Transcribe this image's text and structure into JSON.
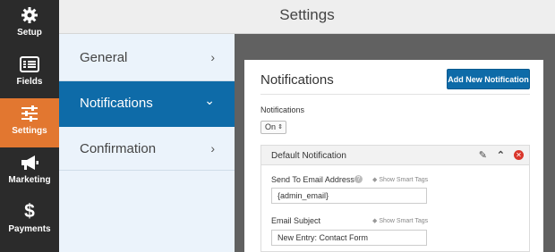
{
  "rail": {
    "items": [
      {
        "label": "Setup",
        "icon": "gear-icon"
      },
      {
        "label": "Fields",
        "icon": "fields-list-icon"
      },
      {
        "label": "Settings",
        "icon": "sliders-icon",
        "active": true
      },
      {
        "label": "Marketing",
        "icon": "megaphone-icon"
      },
      {
        "label": "Payments",
        "icon": "dollar-icon"
      }
    ]
  },
  "header": {
    "title": "Settings"
  },
  "sections": [
    {
      "label": "General",
      "chevron": "›"
    },
    {
      "label": "Notifications",
      "chevron": "⌄",
      "active": true
    },
    {
      "label": "Confirmation",
      "chevron": "›"
    }
  ],
  "panel": {
    "title": "Notifications",
    "add_button": "Add New Notification",
    "notifications_label": "Notifications",
    "notifications_value": "On",
    "block": {
      "title": "Default Notification",
      "send_to_label": "Send To Email Address",
      "send_to_value": "{admin_email}",
      "smart_tags": "Show Smart Tags",
      "subject_label": "Email Subject",
      "subject_value": "New Entry: Contact Form"
    }
  },
  "colors": {
    "accent_blue": "#0e6ba8",
    "active_orange": "#e27730",
    "rail_dark": "#2b2b2b",
    "delete_red": "#d9362b"
  }
}
